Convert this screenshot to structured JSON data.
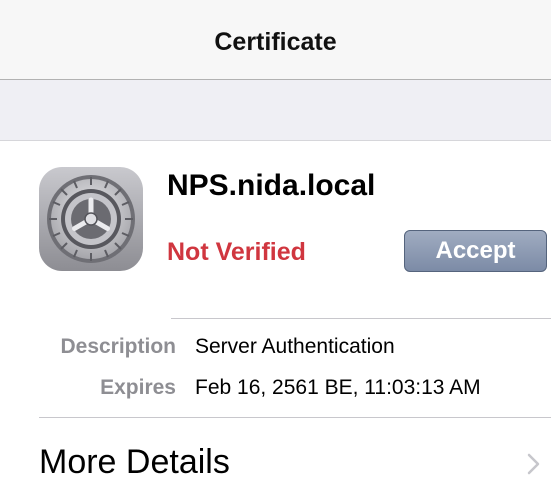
{
  "nav": {
    "title": "Certificate"
  },
  "certificate": {
    "name": "NPS.nida.local",
    "status": "Not Verified",
    "status_color": "#d0363f",
    "icon": "settings-gear-icon",
    "accept_label": "Accept"
  },
  "details": [
    {
      "key": "Description",
      "value": "Server Authentication"
    },
    {
      "key": "Expires",
      "value": "Feb 16, 2561 BE, 11:03:13 AM"
    }
  ],
  "more": {
    "label": "More Details",
    "icon": "chevron-right-icon"
  }
}
